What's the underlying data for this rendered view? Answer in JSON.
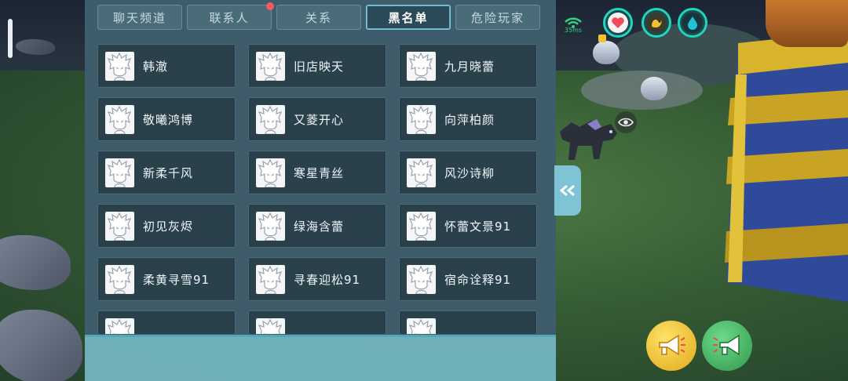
{
  "tabs": [
    {
      "label": "聊天频道",
      "active": false,
      "badge": false
    },
    {
      "label": "联系人",
      "active": false,
      "badge": true
    },
    {
      "label": "关系",
      "active": false,
      "badge": false
    },
    {
      "label": "黑名单",
      "active": true,
      "badge": false
    },
    {
      "label": "危险玩家",
      "active": false,
      "badge": false
    }
  ],
  "blacklist": [
    "韩澈",
    "旧店映天",
    "九月晓蕾",
    "敬曦鸿博",
    "又菱开心",
    "向萍柏颜",
    "新柔千风",
    "寒星青丝",
    "风沙诗柳",
    "初见灰烬",
    "绿海含蕾",
    "怀蕾文景91",
    "柔黄寻雪91",
    "寻春迎松91",
    "宿命诠释91",
    "",
    "",
    ""
  ],
  "hud": {
    "ping": "35ms",
    "ping_color": "#39d07c",
    "stats": [
      {
        "icon": "heart-icon",
        "color": "#f24b5b"
      },
      {
        "icon": "stomach-icon",
        "color": "#f2c230"
      },
      {
        "icon": "water-drop-icon",
        "color": "#22c1d8"
      }
    ]
  },
  "colors": {
    "panel": "#3d5d6c",
    "tab_active": "#2b4a57",
    "card": "#2a414c",
    "voice_yellow": "#f2c230",
    "voice_green": "#3fae5e"
  }
}
